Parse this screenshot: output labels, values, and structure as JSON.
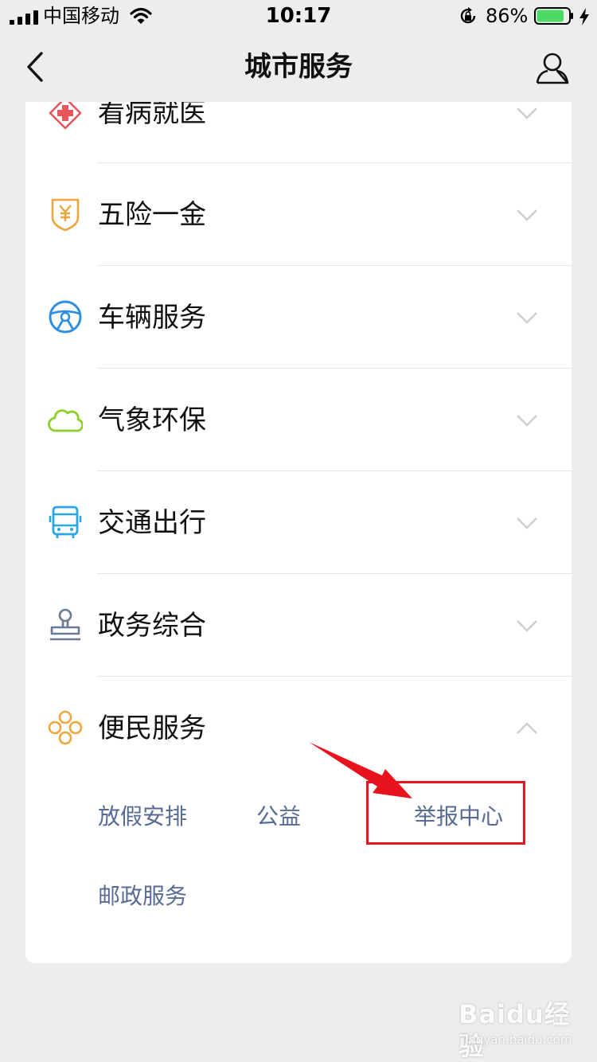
{
  "status_bar": {
    "carrier": "中国移动",
    "time": "10:17",
    "battery_percent_text": "86%",
    "battery_level": 0.86
  },
  "nav": {
    "title": "城市服务",
    "back_icon": "chevron-left-icon",
    "profile_icon": "person-icon"
  },
  "categories": [
    {
      "label": "看病就医",
      "icon": "medical-cross-icon",
      "color": "#e8565b",
      "expanded": false
    },
    {
      "label": "五险一金",
      "icon": "yuan-shield-icon",
      "color": "#f0a53c",
      "expanded": false
    },
    {
      "label": "车辆服务",
      "icon": "steering-wheel-icon",
      "color": "#2f8fe0",
      "expanded": false
    },
    {
      "label": "气象环保",
      "icon": "cloud-icon",
      "color": "#8fcf2a",
      "expanded": false
    },
    {
      "label": "交通出行",
      "icon": "bus-icon",
      "color": "#29a6e6",
      "expanded": false
    },
    {
      "label": "政务综合",
      "icon": "stamp-icon",
      "color": "#6a7a96",
      "expanded": false
    },
    {
      "label": "便民服务",
      "icon": "flower-icon",
      "color": "#f0a53c",
      "expanded": true
    }
  ],
  "convenience_items": [
    "放假安排",
    "公益",
    "举报中心",
    "邮政服务"
  ],
  "highlighted_item": "举报中心",
  "annotation_color": "#e8131c",
  "link_color": "#576b95",
  "watermark": {
    "brand": "Baidu经验",
    "url": "jingyan.baidu.com"
  }
}
